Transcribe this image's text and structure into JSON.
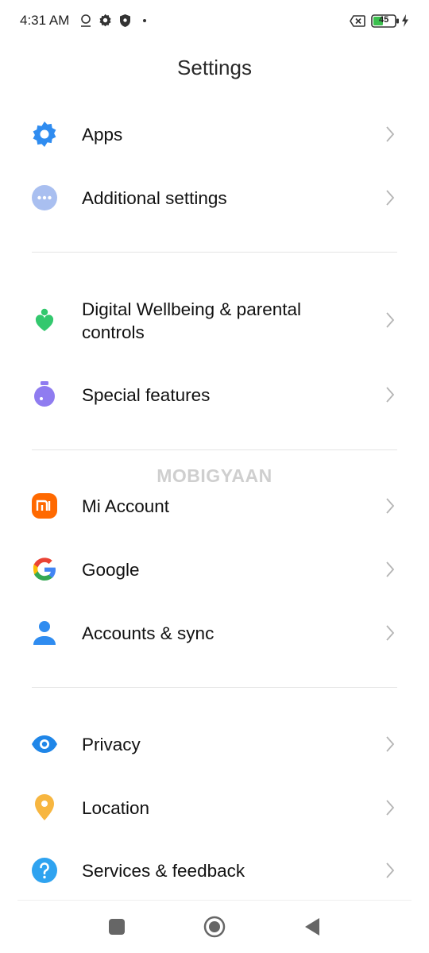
{
  "status_bar": {
    "time": "4:31 AM",
    "battery_level": "45",
    "icons": [
      "location-icon",
      "gear-icon",
      "shield-icon",
      "no-sim-icon",
      "battery-icon",
      "charging-icon"
    ]
  },
  "header": {
    "title": "Settings"
  },
  "sections": [
    {
      "items": [
        {
          "label": "Apps",
          "icon": "gear-icon",
          "color": "#2f8cf0"
        },
        {
          "label": "Additional settings",
          "icon": "more-dots-icon",
          "color": "#a9bff0"
        }
      ]
    },
    {
      "items": [
        {
          "label": "Digital Wellbeing & parental controls",
          "line1": "Digital Wellbeing & parental",
          "line2": "controls",
          "icon": "wellbeing-heart-icon",
          "color": "#33c86e"
        },
        {
          "label": "Special features",
          "icon": "potion-icon",
          "color": "#8f7cf0"
        }
      ]
    },
    {
      "items": [
        {
          "label": "Mi Account",
          "icon": "mi-logo-icon",
          "color": "#ff6900"
        },
        {
          "label": "Google",
          "icon": "google-g-icon",
          "color": "#4285f4"
        },
        {
          "label": "Accounts & sync",
          "icon": "person-icon",
          "color": "#2f8cf0"
        }
      ]
    },
    {
      "items": [
        {
          "label": "Privacy",
          "icon": "eye-icon",
          "color": "#1f86e8"
        },
        {
          "label": "Location",
          "icon": "location-pin-icon",
          "color": "#f7b640"
        },
        {
          "label": "Services & feedback",
          "icon": "help-icon",
          "color": "#2fa3f0"
        }
      ]
    }
  ],
  "watermark": "MOBIGYAAN",
  "nav": {
    "buttons": [
      "recents-icon",
      "home-icon",
      "back-icon"
    ]
  }
}
